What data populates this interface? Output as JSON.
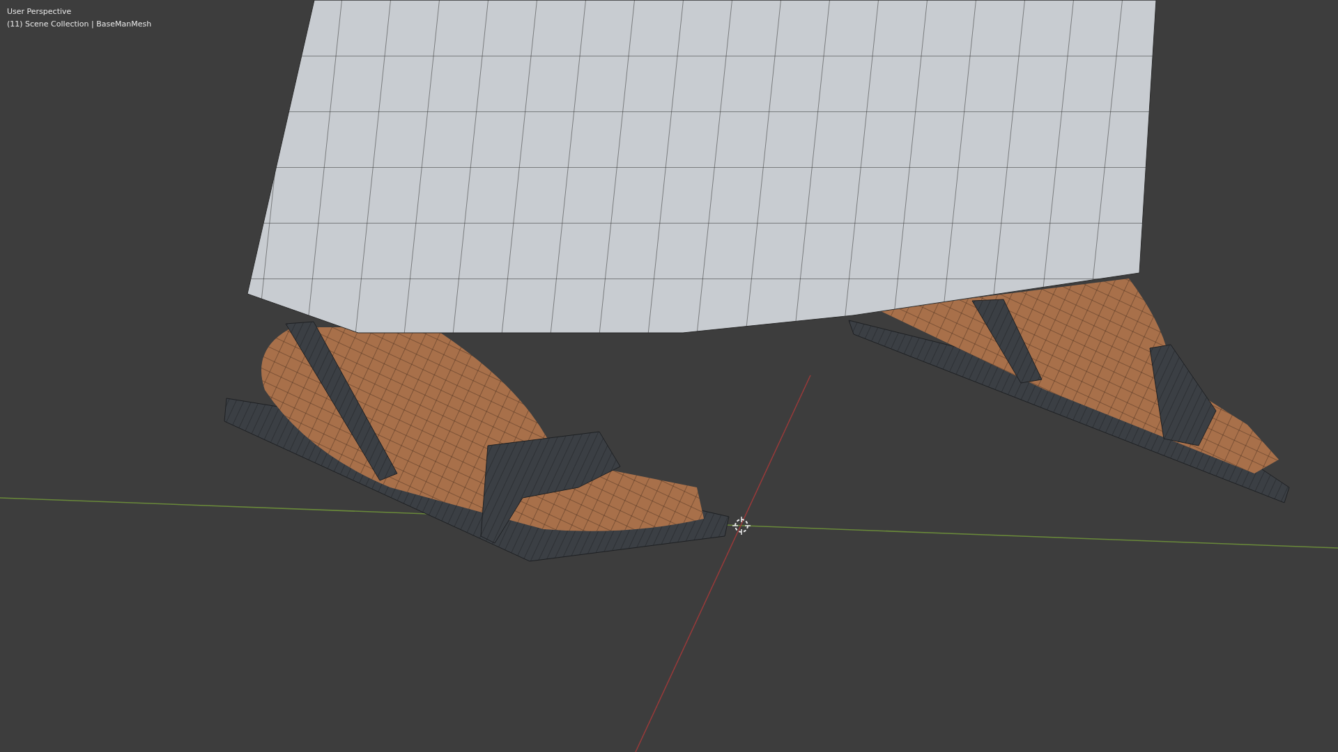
{
  "viewport": {
    "view_name": "User Perspective",
    "context": "(11) Scene Collection | BaseManMesh"
  }
}
